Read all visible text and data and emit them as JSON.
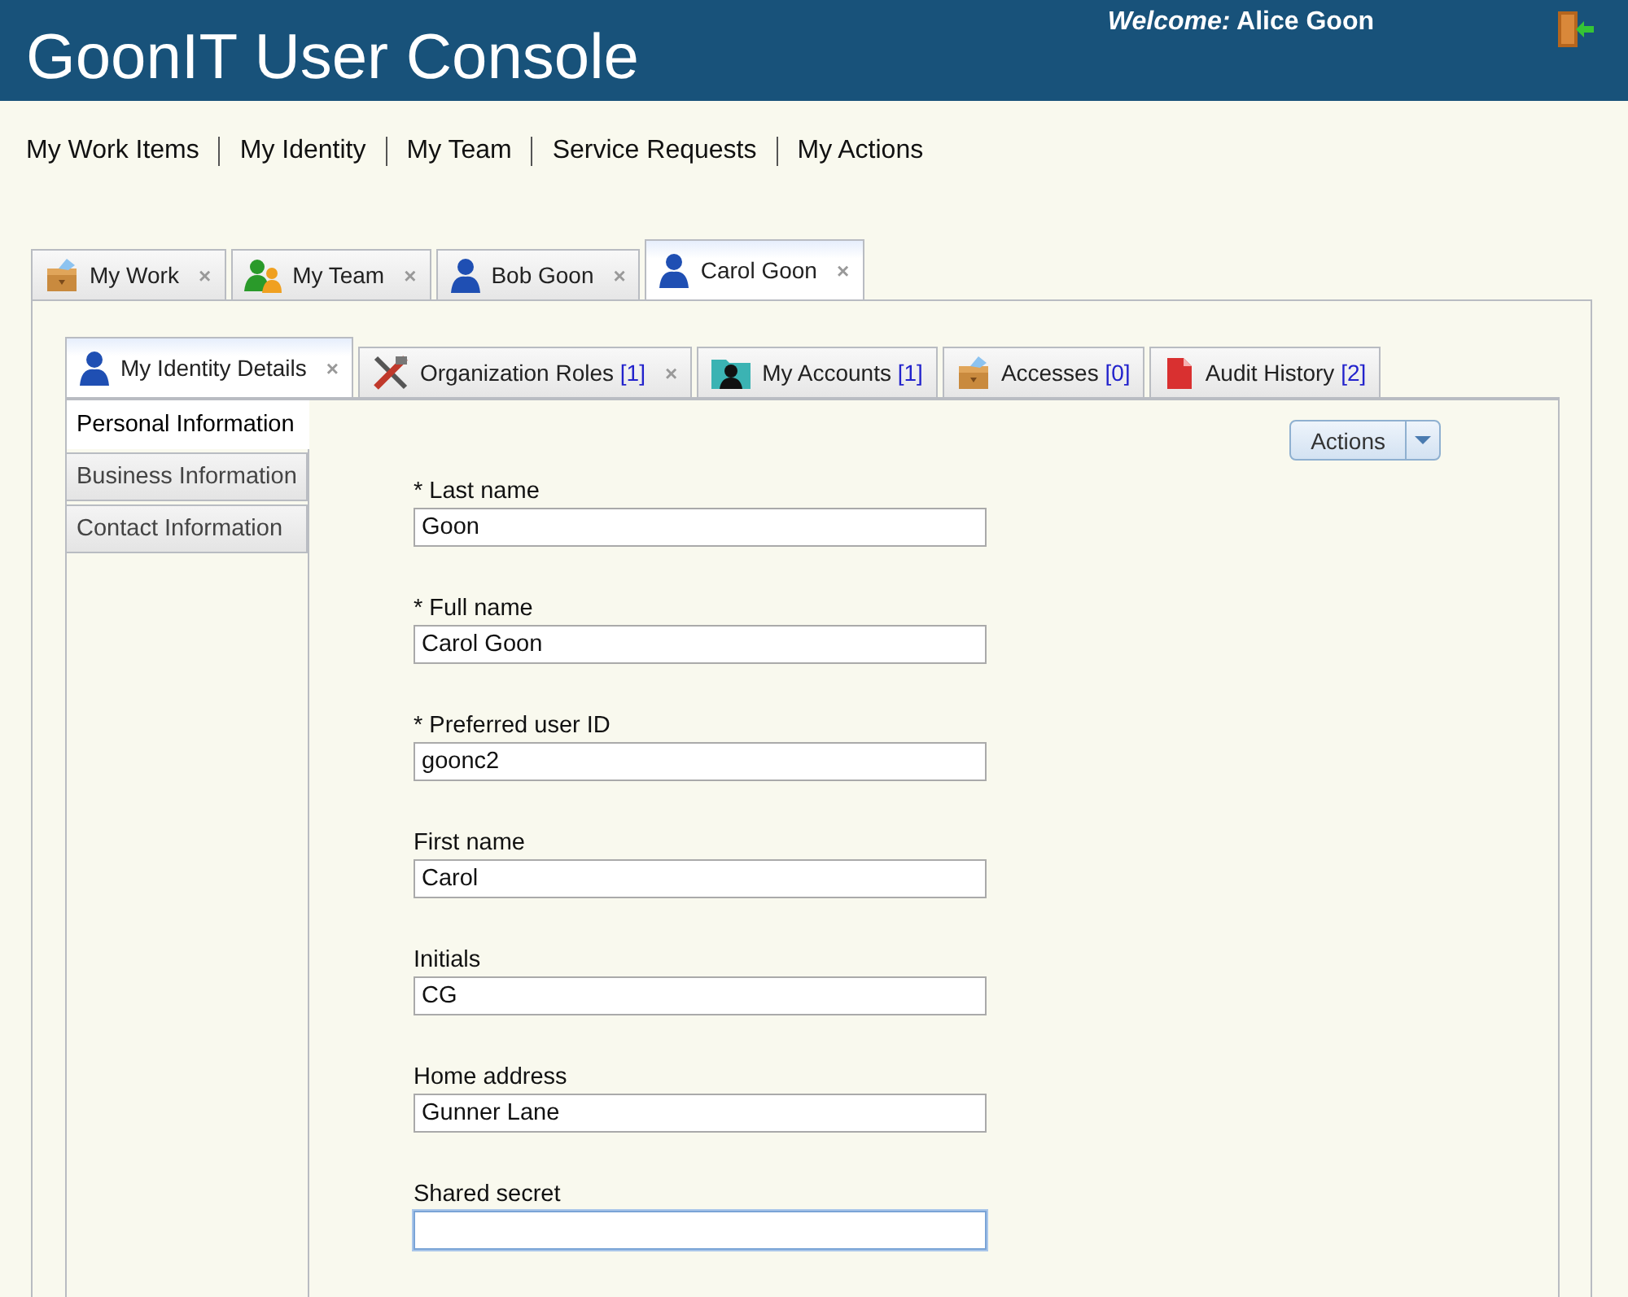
{
  "header": {
    "title": "GoonIT User Console",
    "welcome": "*Welcome:* Alice Goon"
  },
  "nav": [
    {
      "label": "My Work Items"
    },
    {
      "label": "My Identity"
    },
    {
      "label": "My Team"
    },
    {
      "label": "Service Requests"
    },
    {
      "label": "My Actions"
    }
  ],
  "outer_tabs": [
    {
      "label": "My Work",
      "close": "×",
      "selected": false
    },
    {
      "label": "My Team",
      "close": "×",
      "selected": false
    },
    {
      "label": "Bob Goon",
      "close": "×",
      "selected": false
    },
    {
      "label": "Carol Goon",
      "close": "×",
      "selected": true
    }
  ],
  "inner_tabs": [
    {
      "label": "My Identity Details",
      "close": "×",
      "selected": true
    },
    {
      "label": "Organization Roles",
      "count": "[1]",
      "close": "×",
      "selected": false
    },
    {
      "label": "My Accounts",
      "count": "[1]",
      "selected": false
    },
    {
      "label": "Accesses",
      "count": "[0]",
      "selected": false
    },
    {
      "label": "Audit History",
      "count": "[2]",
      "selected": false
    }
  ],
  "sections": [
    {
      "label": "Personal Information",
      "selected": true
    },
    {
      "label": "Business Information",
      "selected": false
    },
    {
      "label": "Contact Information",
      "selected": false
    }
  ],
  "actions_button": {
    "label": "Actions"
  },
  "fields": [
    {
      "label": "* Last name",
      "value": "Goon",
      "focused": false
    },
    {
      "label": "* Full name",
      "value": "Carol Goon",
      "focused": false
    },
    {
      "label": "* Preferred user ID",
      "value": "goonc2",
      "focused": false
    },
    {
      "label": "First name",
      "value": "Carol",
      "focused": false
    },
    {
      "label": "Initials",
      "value": "CG",
      "focused": false
    },
    {
      "label": "Home address",
      "value": "Gunner Lane",
      "focused": false
    },
    {
      "label": "Shared secret",
      "focused": true
    }
  ]
}
